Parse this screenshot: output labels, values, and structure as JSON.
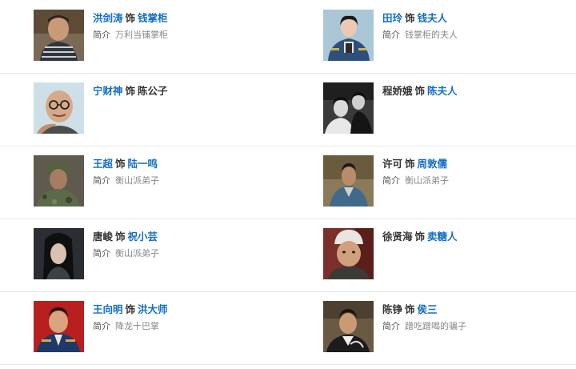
{
  "intro_label": "简介",
  "shi": "饰",
  "rows": [
    [
      {
        "actor": "洪剑涛",
        "actor_link": true,
        "role": "钱掌柜",
        "desc": "万利当铺掌柜"
      },
      {
        "actor": "田玲",
        "actor_link": true,
        "role": "钱夫人",
        "desc": "钱掌柜的夫人"
      }
    ],
    [
      {
        "actor": "宁财神",
        "actor_link": true,
        "role": "陈公子",
        "desc": ""
      },
      {
        "actor": "程娇娥",
        "actor_link": false,
        "role": "陈夫人",
        "desc": ""
      }
    ],
    [
      {
        "actor": "王超",
        "actor_link": true,
        "role": "陆一鸣",
        "desc": "衡山派弟子"
      },
      {
        "actor": "许可",
        "actor_link": false,
        "role": "周敦儒",
        "desc": "衡山派弟子"
      }
    ],
    [
      {
        "actor": "唐峻",
        "actor_link": false,
        "role": "祝小芸",
        "desc": "衡山派弟子"
      },
      {
        "actor": "徐贤海",
        "actor_link": false,
        "role": "卖糖人",
        "desc": ""
      }
    ],
    [
      {
        "actor": "王向明",
        "actor_link": true,
        "role": "洪大师",
        "desc": "降龙十巴掌"
      },
      {
        "actor": "陈铮",
        "actor_link": false,
        "role": "侯三",
        "desc": "蹭吃蹭喝的骗子"
      }
    ]
  ]
}
